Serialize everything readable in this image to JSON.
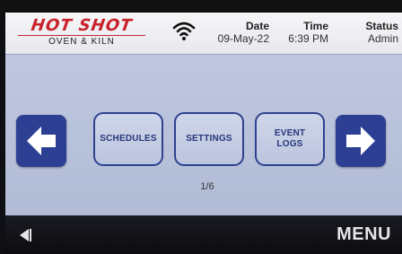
{
  "header": {
    "logo": {
      "brand": "HOT SHOT",
      "tagline": "OVEN & KILN"
    },
    "wifi_icon": "wifi-icon",
    "date": {
      "label": "Date",
      "value": "09-May-22"
    },
    "time": {
      "label": "Time",
      "value": "6:39 PM"
    },
    "status": {
      "label": "Status",
      "value": "Admin"
    }
  },
  "main": {
    "prev_icon": "arrow-left-icon",
    "next_icon": "arrow-right-icon",
    "buttons": [
      {
        "label": "SCHEDULES"
      },
      {
        "label": "SETTINGS"
      },
      {
        "label": "EVENT\nLOGS"
      }
    ],
    "page_indicator": "1/6"
  },
  "footer": {
    "back_icon": "back-icon",
    "menu_label": "MENU"
  },
  "colors": {
    "brand_red": "#c8232c",
    "accent_blue": "#2c3f93",
    "screen_bg": "#b7c1da",
    "footer_bg": "#0c0c10"
  }
}
